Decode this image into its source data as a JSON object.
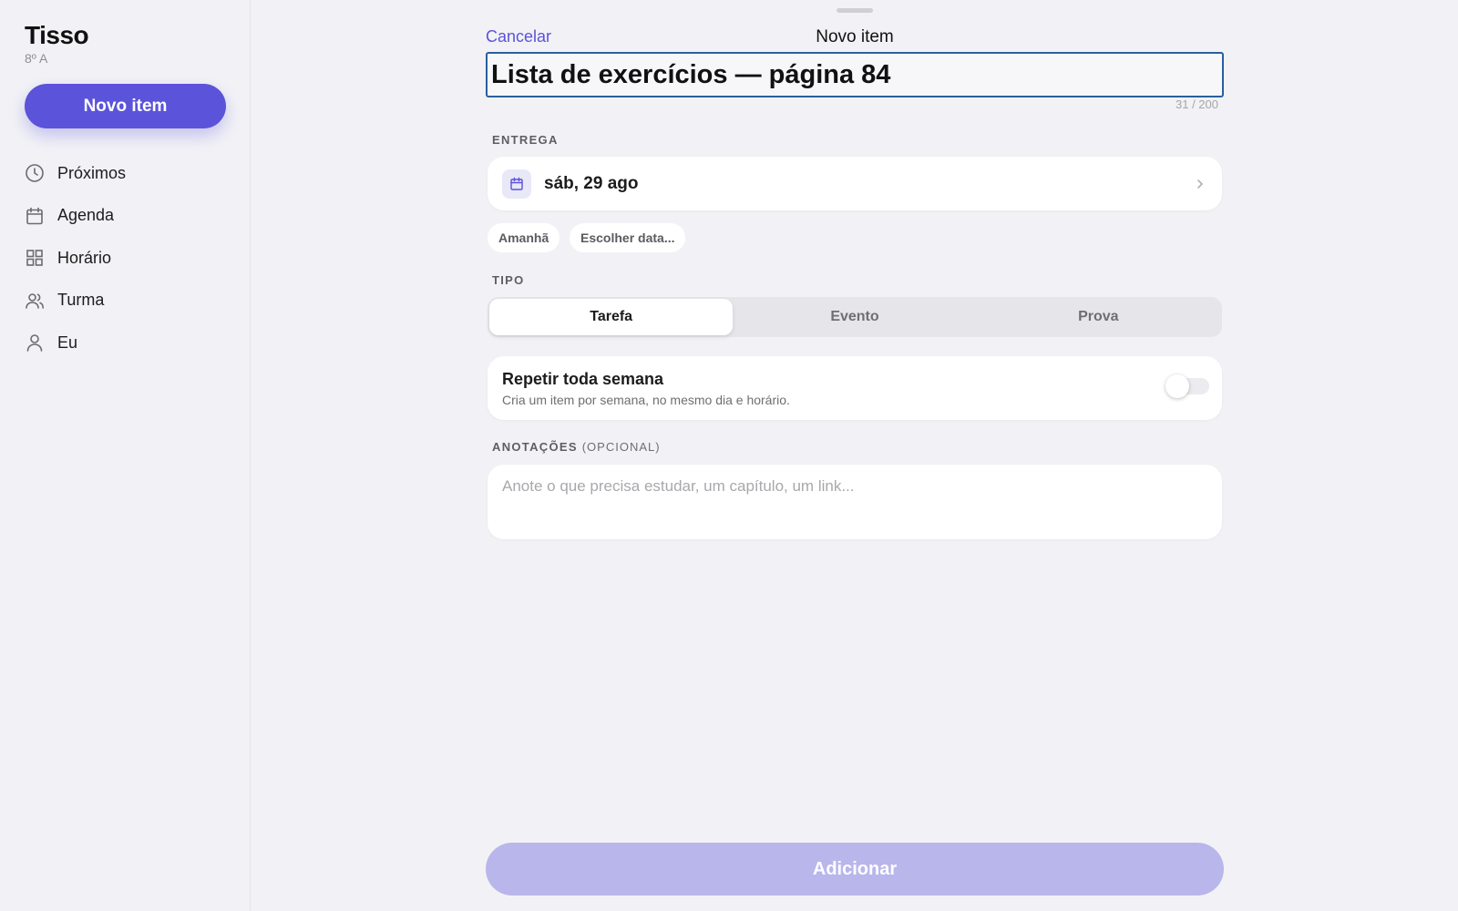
{
  "sidebar": {
    "app_title": "Tisso",
    "app_subtitle": "8º A",
    "new_button_label": "Novo item",
    "items": [
      {
        "label": "Próximos",
        "icon": "clock-icon"
      },
      {
        "label": "Agenda",
        "icon": "calendar-icon"
      },
      {
        "label": "Horário",
        "icon": "grid-icon"
      },
      {
        "label": "Turma",
        "icon": "users-icon"
      },
      {
        "label": "Eu",
        "icon": "user-icon"
      }
    ]
  },
  "sheet": {
    "cancel_label": "Cancelar",
    "title": "Novo item",
    "item_title_value": "Lista de exercícios — página 84",
    "char_counter": "31 / 200",
    "due": {
      "section_label": "ENTREGA",
      "date_value": "sáb, 29 ago",
      "chips": [
        "Amanhã",
        "Escolher data..."
      ]
    },
    "type": {
      "section_label": "TIPO",
      "options": [
        "Tarefa",
        "Evento",
        "Prova"
      ],
      "selected": "Tarefa"
    },
    "repeat": {
      "title": "Repetir toda semana",
      "subtitle": "Cria um item por semana, no mesmo dia e horário.",
      "enabled": false
    },
    "notes": {
      "section_label": "ANOTAÇÕES",
      "optional_label": "(OPCIONAL)",
      "placeholder": "Anote o que precisa estudar, um capítulo, um link..."
    },
    "submit_label": "Adicionar"
  },
  "colors": {
    "accent": "#5b53d9",
    "accent_disabled": "#b9b6ec",
    "background": "#f2f2f6"
  }
}
